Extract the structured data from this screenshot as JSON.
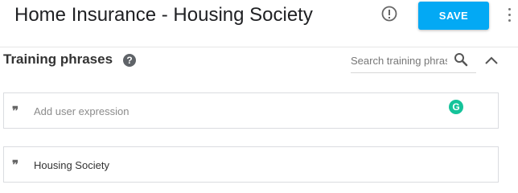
{
  "header": {
    "title": "Home Insurance - Housing Society",
    "save_label": "SAVE",
    "info_icon": "info-circle-icon",
    "more_icon": "more-vertical-icon"
  },
  "training": {
    "title": "Training phrases",
    "help_icon": "help-circle-icon",
    "help_glyph": "?",
    "search_placeholder": "Search training phrases",
    "search_icon": "search-icon",
    "collapse_icon": "chevron-up-icon",
    "add_expression_placeholder": "Add user expression",
    "phrases": [
      "Housing Society"
    ],
    "quote_icon": "quote-icon",
    "quote_glyph": "❞",
    "grammarly_icon": "grammarly-icon",
    "grammarly_glyph": "G"
  },
  "colors": {
    "accent": "#03a9f4",
    "grammarly": "#15c39a",
    "icon_gray": "#5f6368"
  }
}
